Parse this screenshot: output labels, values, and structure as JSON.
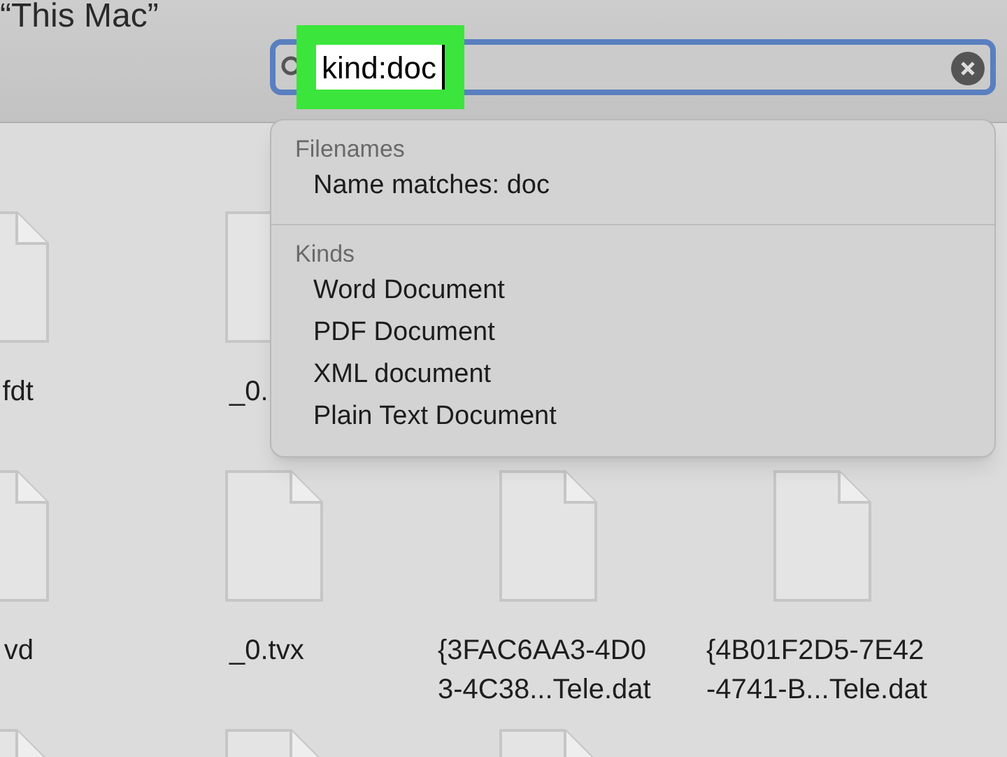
{
  "toolbar": {
    "scope": "“This Mac”"
  },
  "search": {
    "value": "kind:doc",
    "highlighted": true
  },
  "suggestions": [
    {
      "header": "Filenames",
      "items": [
        "Name matches: doc"
      ]
    },
    {
      "header": "Kinds",
      "items": [
        "Word Document",
        "PDF Document",
        "XML document",
        "Plain Text Document"
      ]
    }
  ],
  "files": [
    [
      {
        "kind": "file",
        "name": "fdt"
      },
      {
        "kind": "file",
        "name": "_0."
      }
    ],
    [
      {
        "kind": "file",
        "name": "vd"
      },
      {
        "kind": "file",
        "name": "_0.tvx"
      },
      {
        "kind": "file",
        "name": "{3FAC6AA3-4D0\n3-4C38...Tele.dat"
      },
      {
        "kind": "file",
        "name": "{4B01F2D5-7E42\n-4741-B...Tele.dat"
      }
    ],
    [
      {
        "kind": "icon"
      },
      {
        "kind": "icon"
      },
      {
        "kind": "icon"
      }
    ]
  ]
}
